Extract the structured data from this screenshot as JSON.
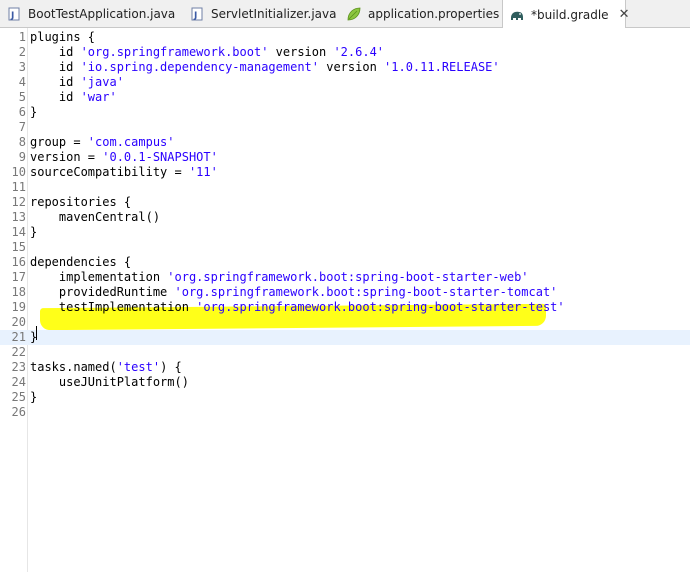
{
  "tabs": [
    {
      "label": "BootTestApplication.java",
      "icon": "java-class-icon"
    },
    {
      "label": "ServletInitializer.java",
      "icon": "java-file-icon"
    },
    {
      "label": "application.properties",
      "icon": "properties-leaf-icon"
    },
    {
      "label": "*build.gradle",
      "icon": "gradle-elephant-icon",
      "active": true,
      "close": "✕"
    }
  ],
  "code_lines": [
    {
      "n": "1",
      "segs": [
        [
          "plugins {",
          ""
        ]
      ]
    },
    {
      "n": "2",
      "segs": [
        [
          "    id ",
          ""
        ],
        [
          "'org.springframework.boot'",
          "str"
        ],
        [
          " version ",
          ""
        ],
        [
          "'2.6.4'",
          "str"
        ]
      ]
    },
    {
      "n": "3",
      "segs": [
        [
          "    id ",
          ""
        ],
        [
          "'io.spring.dependency-management'",
          "str"
        ],
        [
          " version ",
          ""
        ],
        [
          "'1.0.11.RELEASE'",
          "str"
        ]
      ]
    },
    {
      "n": "4",
      "segs": [
        [
          "    id ",
          ""
        ],
        [
          "'java'",
          "str"
        ]
      ]
    },
    {
      "n": "5",
      "segs": [
        [
          "    id ",
          ""
        ],
        [
          "'war'",
          "str"
        ]
      ]
    },
    {
      "n": "6",
      "segs": [
        [
          "}",
          ""
        ]
      ]
    },
    {
      "n": "7",
      "segs": []
    },
    {
      "n": "8",
      "segs": [
        [
          "group = ",
          ""
        ],
        [
          "'com.campus'",
          "str"
        ]
      ]
    },
    {
      "n": "9",
      "segs": [
        [
          "version = ",
          ""
        ],
        [
          "'0.0.1-SNAPSHOT'",
          "str"
        ]
      ]
    },
    {
      "n": "10",
      "segs": [
        [
          "sourceCompatibility = ",
          ""
        ],
        [
          "'11'",
          "str"
        ]
      ]
    },
    {
      "n": "11",
      "segs": []
    },
    {
      "n": "12",
      "segs": [
        [
          "repositories {",
          ""
        ]
      ]
    },
    {
      "n": "13",
      "segs": [
        [
          "    mavenCentral()",
          ""
        ]
      ]
    },
    {
      "n": "14",
      "segs": [
        [
          "}",
          ""
        ]
      ]
    },
    {
      "n": "15",
      "segs": []
    },
    {
      "n": "16",
      "segs": [
        [
          "dependencies {",
          ""
        ]
      ]
    },
    {
      "n": "17",
      "segs": [
        [
          "    implementation ",
          ""
        ],
        [
          "'org.springframework.boot:spring-boot-starter-web'",
          "str"
        ]
      ]
    },
    {
      "n": "18",
      "segs": [
        [
          "    providedRuntime ",
          ""
        ],
        [
          "'org.springframework.boot:spring-boot-starter-tomcat'",
          "str"
        ]
      ]
    },
    {
      "n": "19",
      "segs": [
        [
          "    testImplementation ",
          ""
        ],
        [
          "'org.springframework.boot:spring-boot-starter-test'",
          "str"
        ]
      ]
    },
    {
      "n": "20",
      "segs": []
    },
    {
      "n": "21",
      "segs": [
        [
          "}",
          ""
        ]
      ],
      "current": true
    },
    {
      "n": "22",
      "segs": []
    },
    {
      "n": "23",
      "segs": [
        [
          "tasks.named(",
          ""
        ],
        [
          "'test'",
          "str"
        ],
        [
          ") {",
          ""
        ]
      ]
    },
    {
      "n": "24",
      "segs": [
        [
          "    useJUnitPlatform()",
          ""
        ]
      ]
    },
    {
      "n": "25",
      "segs": [
        [
          "}",
          ""
        ]
      ]
    },
    {
      "n": "26",
      "segs": []
    }
  ],
  "colors": {
    "string": "#2a00ff",
    "line_number": "#787878",
    "current_line": "#e8f2fe",
    "highlight": "#ffff00"
  }
}
